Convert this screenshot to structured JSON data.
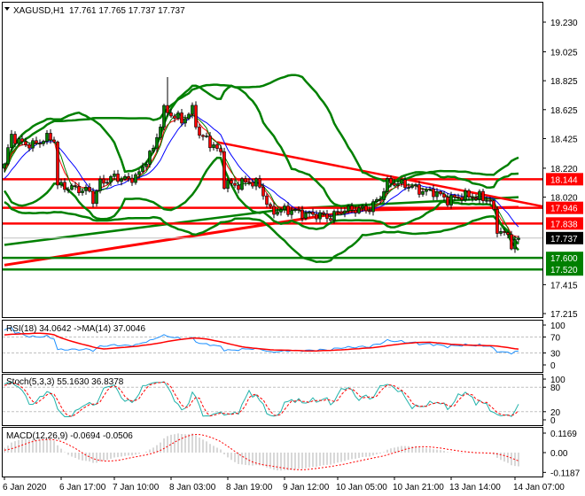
{
  "header": {
    "symbol": "XAGUSD,H1",
    "ohlc": "17.761 17.765 17.737 17.737"
  },
  "price_axis": [
    "19.230",
    "19.025",
    "18.825",
    "18.625",
    "18.425",
    "18.220",
    "18.020",
    "17.415",
    "17.215"
  ],
  "levels": [
    {
      "value": "18.144",
      "color": "#ff0000"
    },
    {
      "value": "17.946",
      "color": "#ff0000"
    },
    {
      "value": "17.838",
      "color": "#ff0000"
    },
    {
      "value": "17.600",
      "color": "#008000"
    },
    {
      "value": "17.520",
      "color": "#008000"
    }
  ],
  "current_price": "17.737",
  "rsi": {
    "label": "RSI(18) 34.0642  ->MA(14) 37.0046",
    "ticks": [
      "100",
      "70",
      "30",
      "0"
    ]
  },
  "stoch": {
    "label": "Stoch(5,3,3) 55.1630 36.8378",
    "ticks": [
      "100",
      "80",
      "20",
      "0"
    ]
  },
  "macd": {
    "label": "MACD(12,26,9) -0.0694 -0.0506",
    "ticks": [
      "0.1169",
      "0.00",
      "-0.1187"
    ]
  },
  "time_axis": [
    {
      "label": "6 Jan 2020",
      "bar": 0
    },
    {
      "label": "6 Jan 17:00",
      "bar": 16
    },
    {
      "label": "7 Jan 10:00",
      "bar": 31
    },
    {
      "label": "8 Jan 03:00",
      "bar": 47
    },
    {
      "label": "8 Jan 19:00",
      "bar": 63
    },
    {
      "label": "9 Jan 12:00",
      "bar": 79
    },
    {
      "label": "10 Jan 05:00",
      "bar": 94
    },
    {
      "label": "10 Jan 21:00",
      "bar": 110
    },
    {
      "label": "13 Jan 14:00",
      "bar": 126
    },
    {
      "label": "14 Jan 07:00",
      "bar": 144
    }
  ],
  "chart_data": {
    "type": "candlestick",
    "symbol": "XAGUSD",
    "timeframe": "H1",
    "ylim": [
      17.215,
      19.23
    ],
    "close_waypoints": [
      [
        -40,
        18.0
      ],
      [
        -20,
        18.15
      ],
      [
        -5,
        18.1
      ],
      [
        0,
        18.25
      ],
      [
        2,
        18.45
      ],
      [
        4,
        18.4
      ],
      [
        8,
        18.38
      ],
      [
        12,
        18.43
      ],
      [
        14,
        18.42
      ],
      [
        15,
        18.1
      ],
      [
        20,
        18.08
      ],
      [
        24,
        18.06
      ],
      [
        25,
        18.0
      ],
      [
        27,
        18.12
      ],
      [
        31,
        18.16
      ],
      [
        35,
        18.14
      ],
      [
        38,
        18.18
      ],
      [
        40,
        18.28
      ],
      [
        42,
        18.35
      ],
      [
        45,
        18.62
      ],
      [
        48,
        18.58
      ],
      [
        50,
        18.55
      ],
      [
        53,
        18.62
      ],
      [
        55,
        18.45
      ],
      [
        58,
        18.4
      ],
      [
        61,
        18.32
      ],
      [
        62,
        18.12
      ],
      [
        65,
        18.1
      ],
      [
        69,
        18.13
      ],
      [
        72,
        18.1
      ],
      [
        75,
        17.92
      ],
      [
        78,
        17.93
      ],
      [
        81,
        17.93
      ],
      [
        85,
        17.9
      ],
      [
        88,
        17.9
      ],
      [
        92,
        17.88
      ],
      [
        95,
        17.93
      ],
      [
        103,
        17.94
      ],
      [
        106,
        18.02
      ],
      [
        108,
        18.12
      ],
      [
        110,
        18.12
      ],
      [
        114,
        18.1
      ],
      [
        118,
        18.06
      ],
      [
        121,
        18.06
      ],
      [
        125,
        18.0
      ],
      [
        129,
        18.03
      ],
      [
        134,
        18.02
      ],
      [
        137,
        18.0
      ],
      [
        139,
        17.8
      ],
      [
        141,
        17.77
      ],
      [
        143,
        17.7
      ],
      [
        145,
        17.737
      ]
    ],
    "spike_high": {
      "bar": 46,
      "price": 18.85
    },
    "long_ma_red": [
      [
        0,
        17.55
      ],
      [
        100,
        17.93
      ],
      [
        145,
        17.95
      ]
    ],
    "long_ma_green": [
      [
        0,
        17.69
      ],
      [
        80,
        17.94
      ],
      [
        145,
        18.02
      ]
    ],
    "trendline": [
      [
        60,
        18.4
      ],
      [
        152,
        17.955
      ]
    ],
    "horizontal_levels": [
      18.144,
      17.946,
      17.838,
      17.6,
      17.52
    ],
    "current": 17.737,
    "indicators": [
      "EMA(5)",
      "SMA(10)",
      "Bollinger(20,2)",
      "Bollinger(40,2.4)",
      "RSI(18)",
      "Stoch(5,3,3)",
      "MACD(12,26,9)"
    ]
  }
}
